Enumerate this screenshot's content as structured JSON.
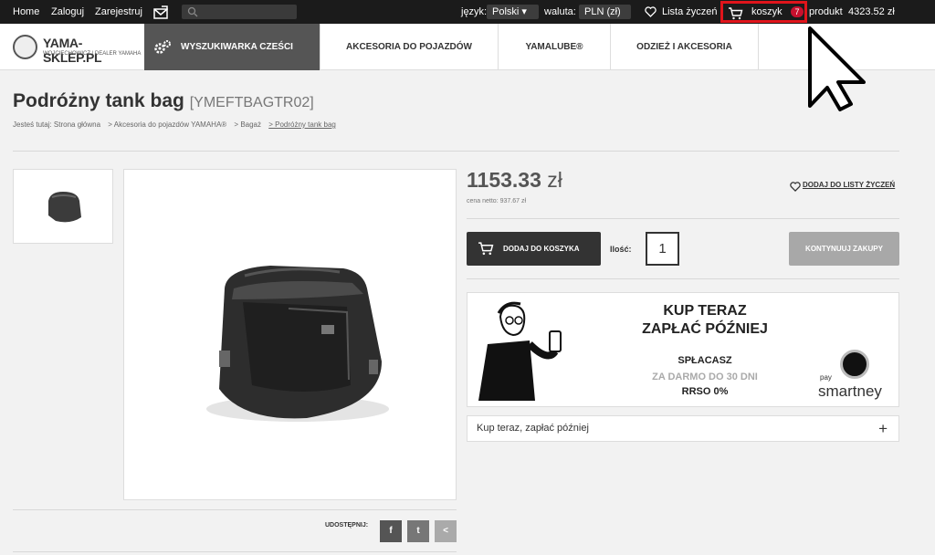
{
  "topbar": {
    "home": "Home",
    "login": "Zaloguj",
    "register": "Zarejestruj",
    "language_label": "język:",
    "language_value": "Polski",
    "currency_label": "waluta:",
    "currency_value": "PLN (zł)",
    "wishlist": "Lista życzeń",
    "cart": "koszyk",
    "cart_count": "7",
    "cart_product_label": "produkt",
    "cart_total": "4323.52 zł"
  },
  "logo": {
    "name": "YAMA-SKLEP.PL",
    "subtitle": "WOJCIECHOWICZ | DEALER YAMAHA"
  },
  "nav": {
    "parts_search": "WYSZUKIWARKA CZEŚCI",
    "accessories": "AKCESORIA DO POJAZDÓW",
    "yamalube": "YAMALUBE®",
    "clothing": "ODZIEŻ I AKCESORIA"
  },
  "product": {
    "title": "Podróżny tank bag",
    "code": "[YMEFTBAGTR02]",
    "price": "1153.33",
    "currency": "zł",
    "net_price": "cena netto: 937.67 zł",
    "wishlist_add": "DODAJ DO LISTY ŻYCZEŃ",
    "add_to_cart": "DODAJ DO KOSZYKA",
    "quantity_label": "Ilość:",
    "quantity": "1",
    "continue": "KONTYNUUJ ZAKUPY",
    "share_label": "UDOSTĘPNIJ:"
  },
  "breadcrumb": {
    "prefix": "Jesteś tutaj: Strona główna",
    "c1": "> Akcesoria do pojazdów YAMAHA®",
    "c2": "> Bagaż",
    "c3": "> Podróżny tank bag"
  },
  "banner": {
    "line1": "KUP TERAZ",
    "line2": "ZAPŁAĆ PÓŹNIEJ",
    "line3": "SPŁACASZ",
    "line4": "ZA DARMO DO 30 DNI",
    "line5": "RRSO 0%",
    "brand_small": "pay",
    "brand": "smartney"
  },
  "accordion": {
    "label": "Kup teraz, zapłać później",
    "plus": "+"
  },
  "share": {
    "facebook": "f",
    "twitter": "t",
    "share": "<"
  },
  "colors": {
    "topbar": "#1b1b1b",
    "highlight": "#e0141b",
    "badge": "#c8102e",
    "active_nav": "#555555"
  }
}
